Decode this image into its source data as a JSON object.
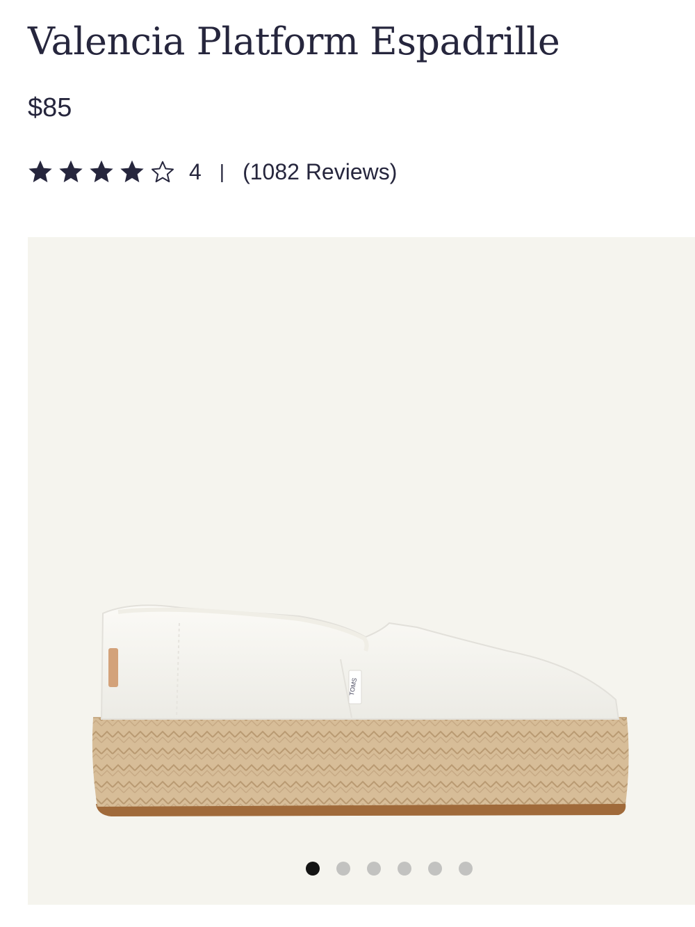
{
  "product": {
    "title": "Valencia Platform Espadrille",
    "price": "$85",
    "rating": {
      "stars_filled": 4,
      "stars_total": 5,
      "value": "4",
      "separator": "|",
      "reviews_label": "(1082 Reviews)"
    },
    "image": {
      "brand_label": "TOMS"
    }
  },
  "gallery": {
    "total_images": 6,
    "active_index": 0
  },
  "colors": {
    "text": "#26263d",
    "gallery_bg": "#f5f4ee",
    "dot_active": "#141414",
    "dot_inactive": "#c2c2c0"
  }
}
